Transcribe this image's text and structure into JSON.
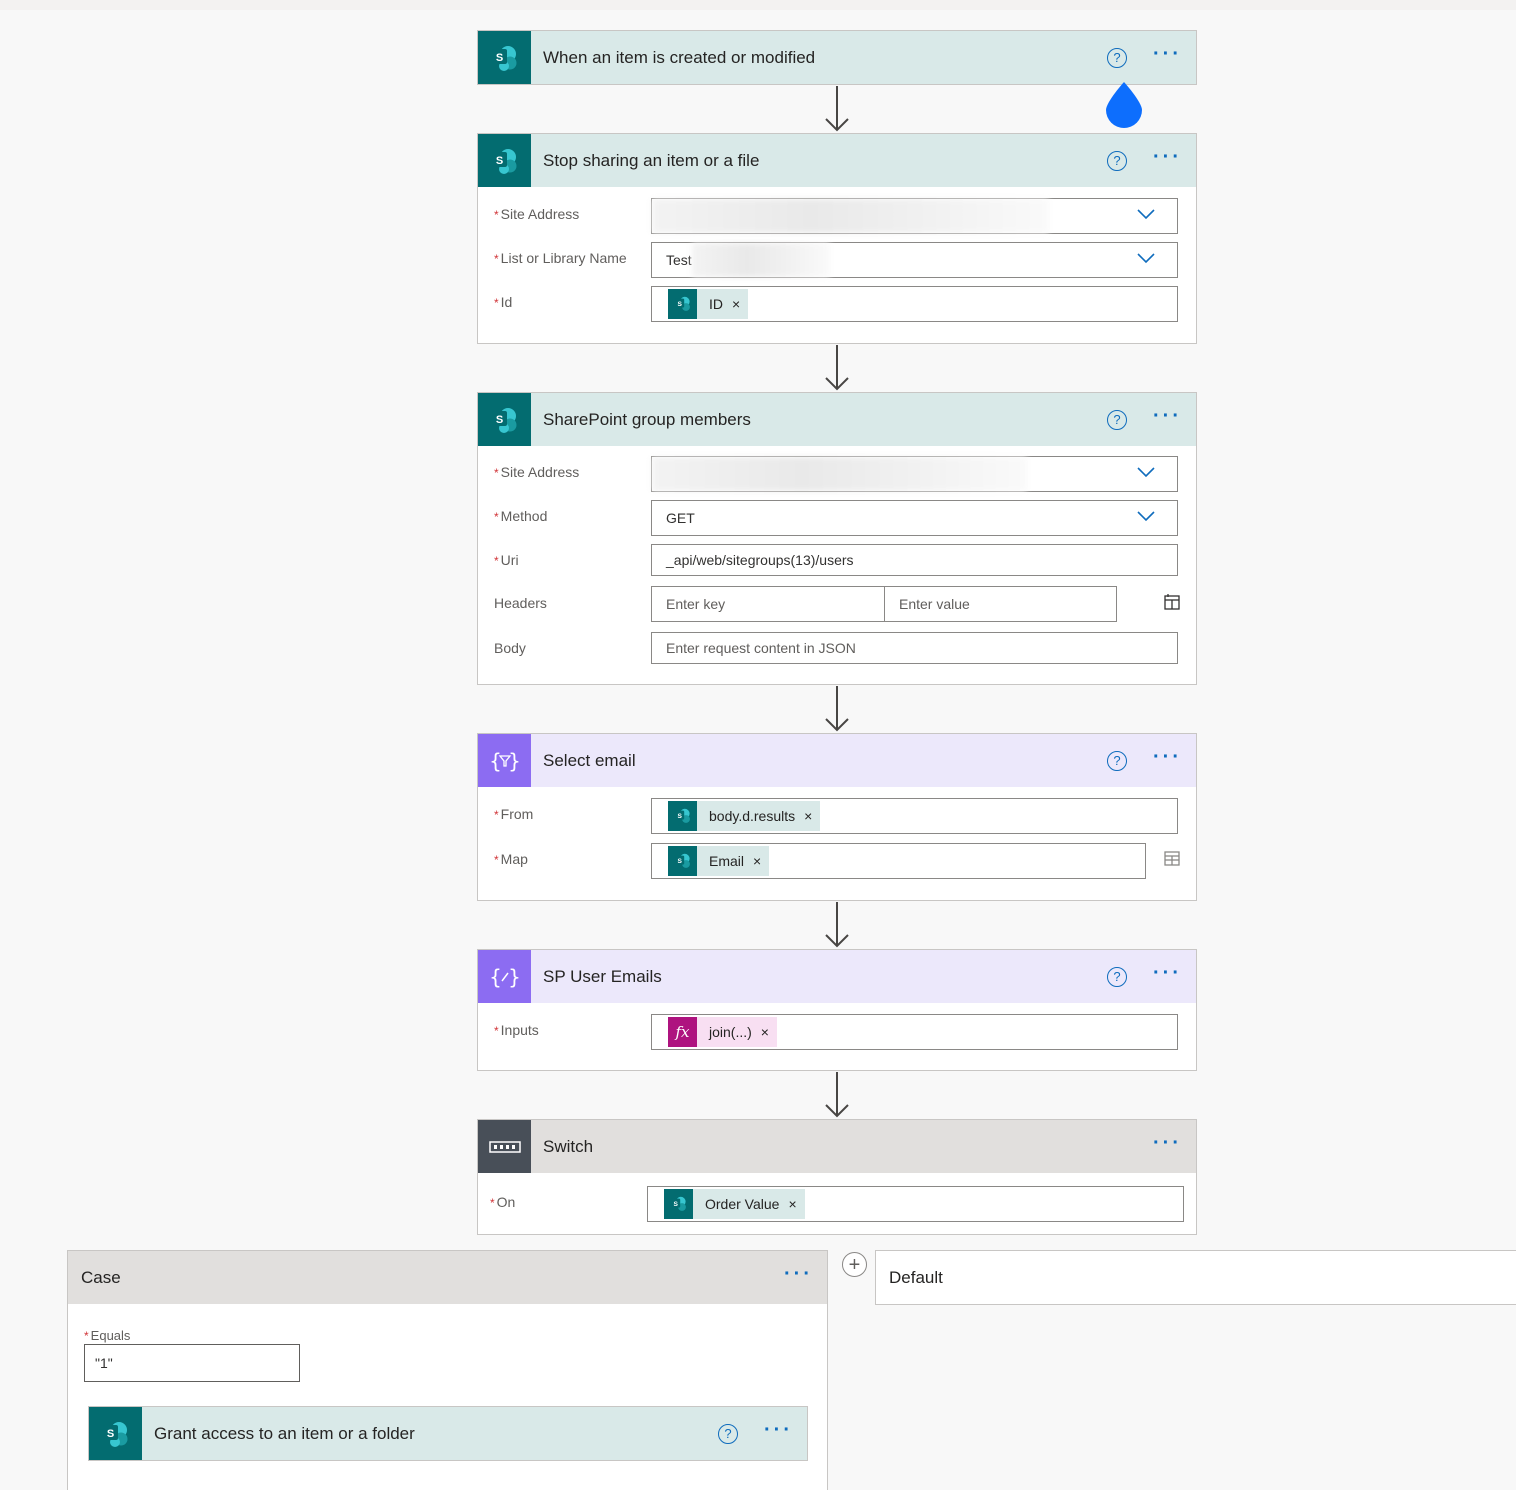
{
  "colors": {
    "accent": "#0f6cbd",
    "sharepoint": "#036c70",
    "data_ops": "#8c6cf2",
    "control": "#484f58",
    "expression": "#ae137f",
    "required": "#d13438"
  },
  "flow": {
    "trigger": {
      "title": "When an item is created or modified",
      "icon": "sharepoint-icon"
    },
    "stop_sharing": {
      "title": "Stop sharing an item or a file",
      "icon": "sharepoint-icon",
      "fields": {
        "site_address": {
          "label": "Site Address",
          "value": ""
        },
        "list_name": {
          "label": "List or Library Name",
          "value": "Test"
        },
        "id": {
          "label": "Id",
          "token": "ID"
        }
      }
    },
    "group_members": {
      "title": "SharePoint group members",
      "icon": "sharepoint-icon",
      "fields": {
        "site_address": {
          "label": "Site Address",
          "value": ""
        },
        "method": {
          "label": "Method",
          "value": "GET"
        },
        "uri": {
          "label": "Uri",
          "value": "_api/web/sitegroups(13)/users"
        },
        "headers": {
          "label": "Headers",
          "key_placeholder": "Enter key",
          "value_placeholder": "Enter value"
        },
        "body": {
          "label": "Body",
          "placeholder": "Enter request content in JSON"
        }
      }
    },
    "select_email": {
      "title": "Select email",
      "icon": "data-operation-icon",
      "fields": {
        "from": {
          "label": "From",
          "token": "body.d.results"
        },
        "map": {
          "label": "Map",
          "token": "Email"
        }
      }
    },
    "sp_user_emails": {
      "title": "SP User Emails",
      "icon": "compose-icon",
      "fields": {
        "inputs": {
          "label": "Inputs",
          "token": "join(...)"
        }
      }
    },
    "switch": {
      "title": "Switch",
      "icon": "switch-icon",
      "fields": {
        "on": {
          "label": "On",
          "token": "Order Value"
        }
      }
    },
    "case": {
      "title": "Case",
      "equals_label": "Equals",
      "equals_value": "\"1\"",
      "action": {
        "title": "Grant access to an item or a folder",
        "icon": "sharepoint-icon"
      }
    },
    "default": {
      "title": "Default"
    }
  }
}
